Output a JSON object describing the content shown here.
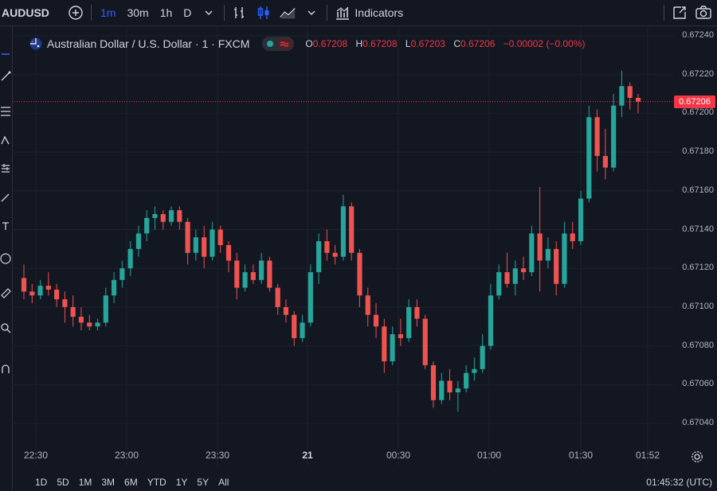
{
  "toolbar": {
    "symbol": "AUDUSD",
    "intervals": [
      "1m",
      "30m",
      "1h",
      "D"
    ],
    "active_interval": "1m",
    "indicators_label": "Indicators"
  },
  "legend": {
    "title": "Australian Dollar / U.S. Dollar · 1 · FXCM",
    "open_key": "O",
    "open": "0.67208",
    "high_key": "H",
    "high": "0.67208",
    "low_key": "L",
    "low": "0.67203",
    "close_key": "C",
    "close": "0.67206",
    "change": "−0.00002 (−0.00%)"
  },
  "colors": {
    "up": "#26a69a",
    "down": "#ef5350",
    "accent": "#2962ff",
    "bg": "#131722",
    "last_price": "#f23645"
  },
  "chart_data": {
    "type": "candlestick",
    "y_ticks": [
      "0.67240",
      "0.67220",
      "0.67200",
      "0.67180",
      "0.67160",
      "0.67140",
      "0.67120",
      "0.67100",
      "0.67080",
      "0.67060",
      "0.67040"
    ],
    "ylim": [
      0.6704,
      0.6724
    ],
    "x_ticks": [
      "22:30",
      "23:00",
      "23:30",
      "21",
      "00:30",
      "01:00",
      "01:30",
      "01:52"
    ],
    "last_price": "0.67206",
    "ohlc": [
      [
        0.67115,
        0.67122,
        0.67104,
        0.67108
      ],
      [
        0.67108,
        0.67112,
        0.67102,
        0.67106
      ],
      [
        0.67106,
        0.67114,
        0.67104,
        0.67111
      ],
      [
        0.67111,
        0.67118,
        0.67106,
        0.67109
      ],
      [
        0.67109,
        0.67112,
        0.671,
        0.67104
      ],
      [
        0.67104,
        0.67108,
        0.67092,
        0.671
      ],
      [
        0.671,
        0.67106,
        0.6709,
        0.67095
      ],
      [
        0.67095,
        0.671,
        0.67088,
        0.67092
      ],
      [
        0.67092,
        0.67096,
        0.67088,
        0.6709
      ],
      [
        0.6709,
        0.67094,
        0.67088,
        0.67092
      ],
      [
        0.67092,
        0.6711,
        0.6709,
        0.67106
      ],
      [
        0.67106,
        0.67118,
        0.67102,
        0.67114
      ],
      [
        0.67114,
        0.67124,
        0.6711,
        0.6712
      ],
      [
        0.6712,
        0.67134,
        0.67116,
        0.6713
      ],
      [
        0.6713,
        0.67142,
        0.67126,
        0.67138
      ],
      [
        0.67138,
        0.6715,
        0.67134,
        0.67146
      ],
      [
        0.67146,
        0.67152,
        0.6714,
        0.67148
      ],
      [
        0.67148,
        0.6715,
        0.6714,
        0.67144
      ],
      [
        0.67144,
        0.67152,
        0.67142,
        0.6715
      ],
      [
        0.6715,
        0.67152,
        0.6714,
        0.67144
      ],
      [
        0.67144,
        0.67146,
        0.67122,
        0.67128
      ],
      [
        0.67128,
        0.6714,
        0.67124,
        0.67136
      ],
      [
        0.67136,
        0.67142,
        0.6712,
        0.67126
      ],
      [
        0.67126,
        0.67144,
        0.67124,
        0.6714
      ],
      [
        0.6714,
        0.67142,
        0.67128,
        0.67132
      ],
      [
        0.67132,
        0.67134,
        0.67118,
        0.67124
      ],
      [
        0.67124,
        0.67128,
        0.67104,
        0.6711
      ],
      [
        0.6711,
        0.67122,
        0.67108,
        0.67118
      ],
      [
        0.67118,
        0.67122,
        0.67112,
        0.67114
      ],
      [
        0.67114,
        0.67128,
        0.67112,
        0.67124
      ],
      [
        0.67124,
        0.67126,
        0.67108,
        0.6711
      ],
      [
        0.6711,
        0.67112,
        0.67096,
        0.671
      ],
      [
        0.671,
        0.67104,
        0.67092,
        0.67096
      ],
      [
        0.67096,
        0.67098,
        0.6708,
        0.67084
      ],
      [
        0.67084,
        0.67096,
        0.67082,
        0.67092
      ],
      [
        0.67092,
        0.67122,
        0.6709,
        0.67118
      ],
      [
        0.67118,
        0.67138,
        0.67112,
        0.67134
      ],
      [
        0.67134,
        0.6714,
        0.67124,
        0.67128
      ],
      [
        0.67128,
        0.67132,
        0.67122,
        0.67126
      ],
      [
        0.67126,
        0.67158,
        0.67124,
        0.67152
      ],
      [
        0.67152,
        0.67154,
        0.67124,
        0.67128
      ],
      [
        0.67128,
        0.6713,
        0.671,
        0.67106
      ],
      [
        0.67106,
        0.6711,
        0.6709,
        0.67096
      ],
      [
        0.67096,
        0.67102,
        0.67084,
        0.6709
      ],
      [
        0.6709,
        0.67094,
        0.67066,
        0.67072
      ],
      [
        0.67072,
        0.6709,
        0.6707,
        0.67086
      ],
      [
        0.67086,
        0.67094,
        0.6708,
        0.67084
      ],
      [
        0.67084,
        0.67104,
        0.67082,
        0.671
      ],
      [
        0.671,
        0.67104,
        0.6709,
        0.67094
      ],
      [
        0.67094,
        0.67096,
        0.67068,
        0.6707
      ],
      [
        0.6707,
        0.67072,
        0.67048,
        0.67052
      ],
      [
        0.67052,
        0.67066,
        0.6705,
        0.67062
      ],
      [
        0.67062,
        0.67068,
        0.67052,
        0.67056
      ],
      [
        0.67056,
        0.67062,
        0.67046,
        0.67058
      ],
      [
        0.67058,
        0.6707,
        0.67056,
        0.67066
      ],
      [
        0.67066,
        0.67074,
        0.67062,
        0.67068
      ],
      [
        0.67068,
        0.67086,
        0.67066,
        0.6708
      ],
      [
        0.6708,
        0.67112,
        0.67078,
        0.67106
      ],
      [
        0.67106,
        0.67122,
        0.67104,
        0.67118
      ],
      [
        0.67118,
        0.67128,
        0.6711,
        0.67112
      ],
      [
        0.67112,
        0.67124,
        0.67106,
        0.6712
      ],
      [
        0.6712,
        0.67126,
        0.67114,
        0.67118
      ],
      [
        0.67118,
        0.67142,
        0.67116,
        0.67138
      ],
      [
        0.67138,
        0.67162,
        0.67108,
        0.67124
      ],
      [
        0.67124,
        0.67136,
        0.6712,
        0.6713
      ],
      [
        0.6713,
        0.67134,
        0.67106,
        0.67112
      ],
      [
        0.67112,
        0.67144,
        0.6711,
        0.67138
      ],
      [
        0.67138,
        0.67144,
        0.6713,
        0.67134
      ],
      [
        0.67134,
        0.6716,
        0.67132,
        0.67156
      ],
      [
        0.67156,
        0.67204,
        0.67154,
        0.67198
      ],
      [
        0.67198,
        0.67202,
        0.6717,
        0.67178
      ],
      [
        0.67178,
        0.67192,
        0.67166,
        0.67172
      ],
      [
        0.67172,
        0.6721,
        0.6717,
        0.67204
      ],
      [
        0.67204,
        0.67222,
        0.67198,
        0.67214
      ],
      [
        0.67214,
        0.67216,
        0.67202,
        0.67208
      ],
      [
        0.67208,
        0.6721,
        0.672,
        0.67206
      ]
    ]
  },
  "ranges": [
    "1D",
    "5D",
    "1M",
    "3M",
    "6M",
    "YTD",
    "1Y",
    "5Y",
    "All"
  ],
  "clock": "01:45:32 (UTC)"
}
